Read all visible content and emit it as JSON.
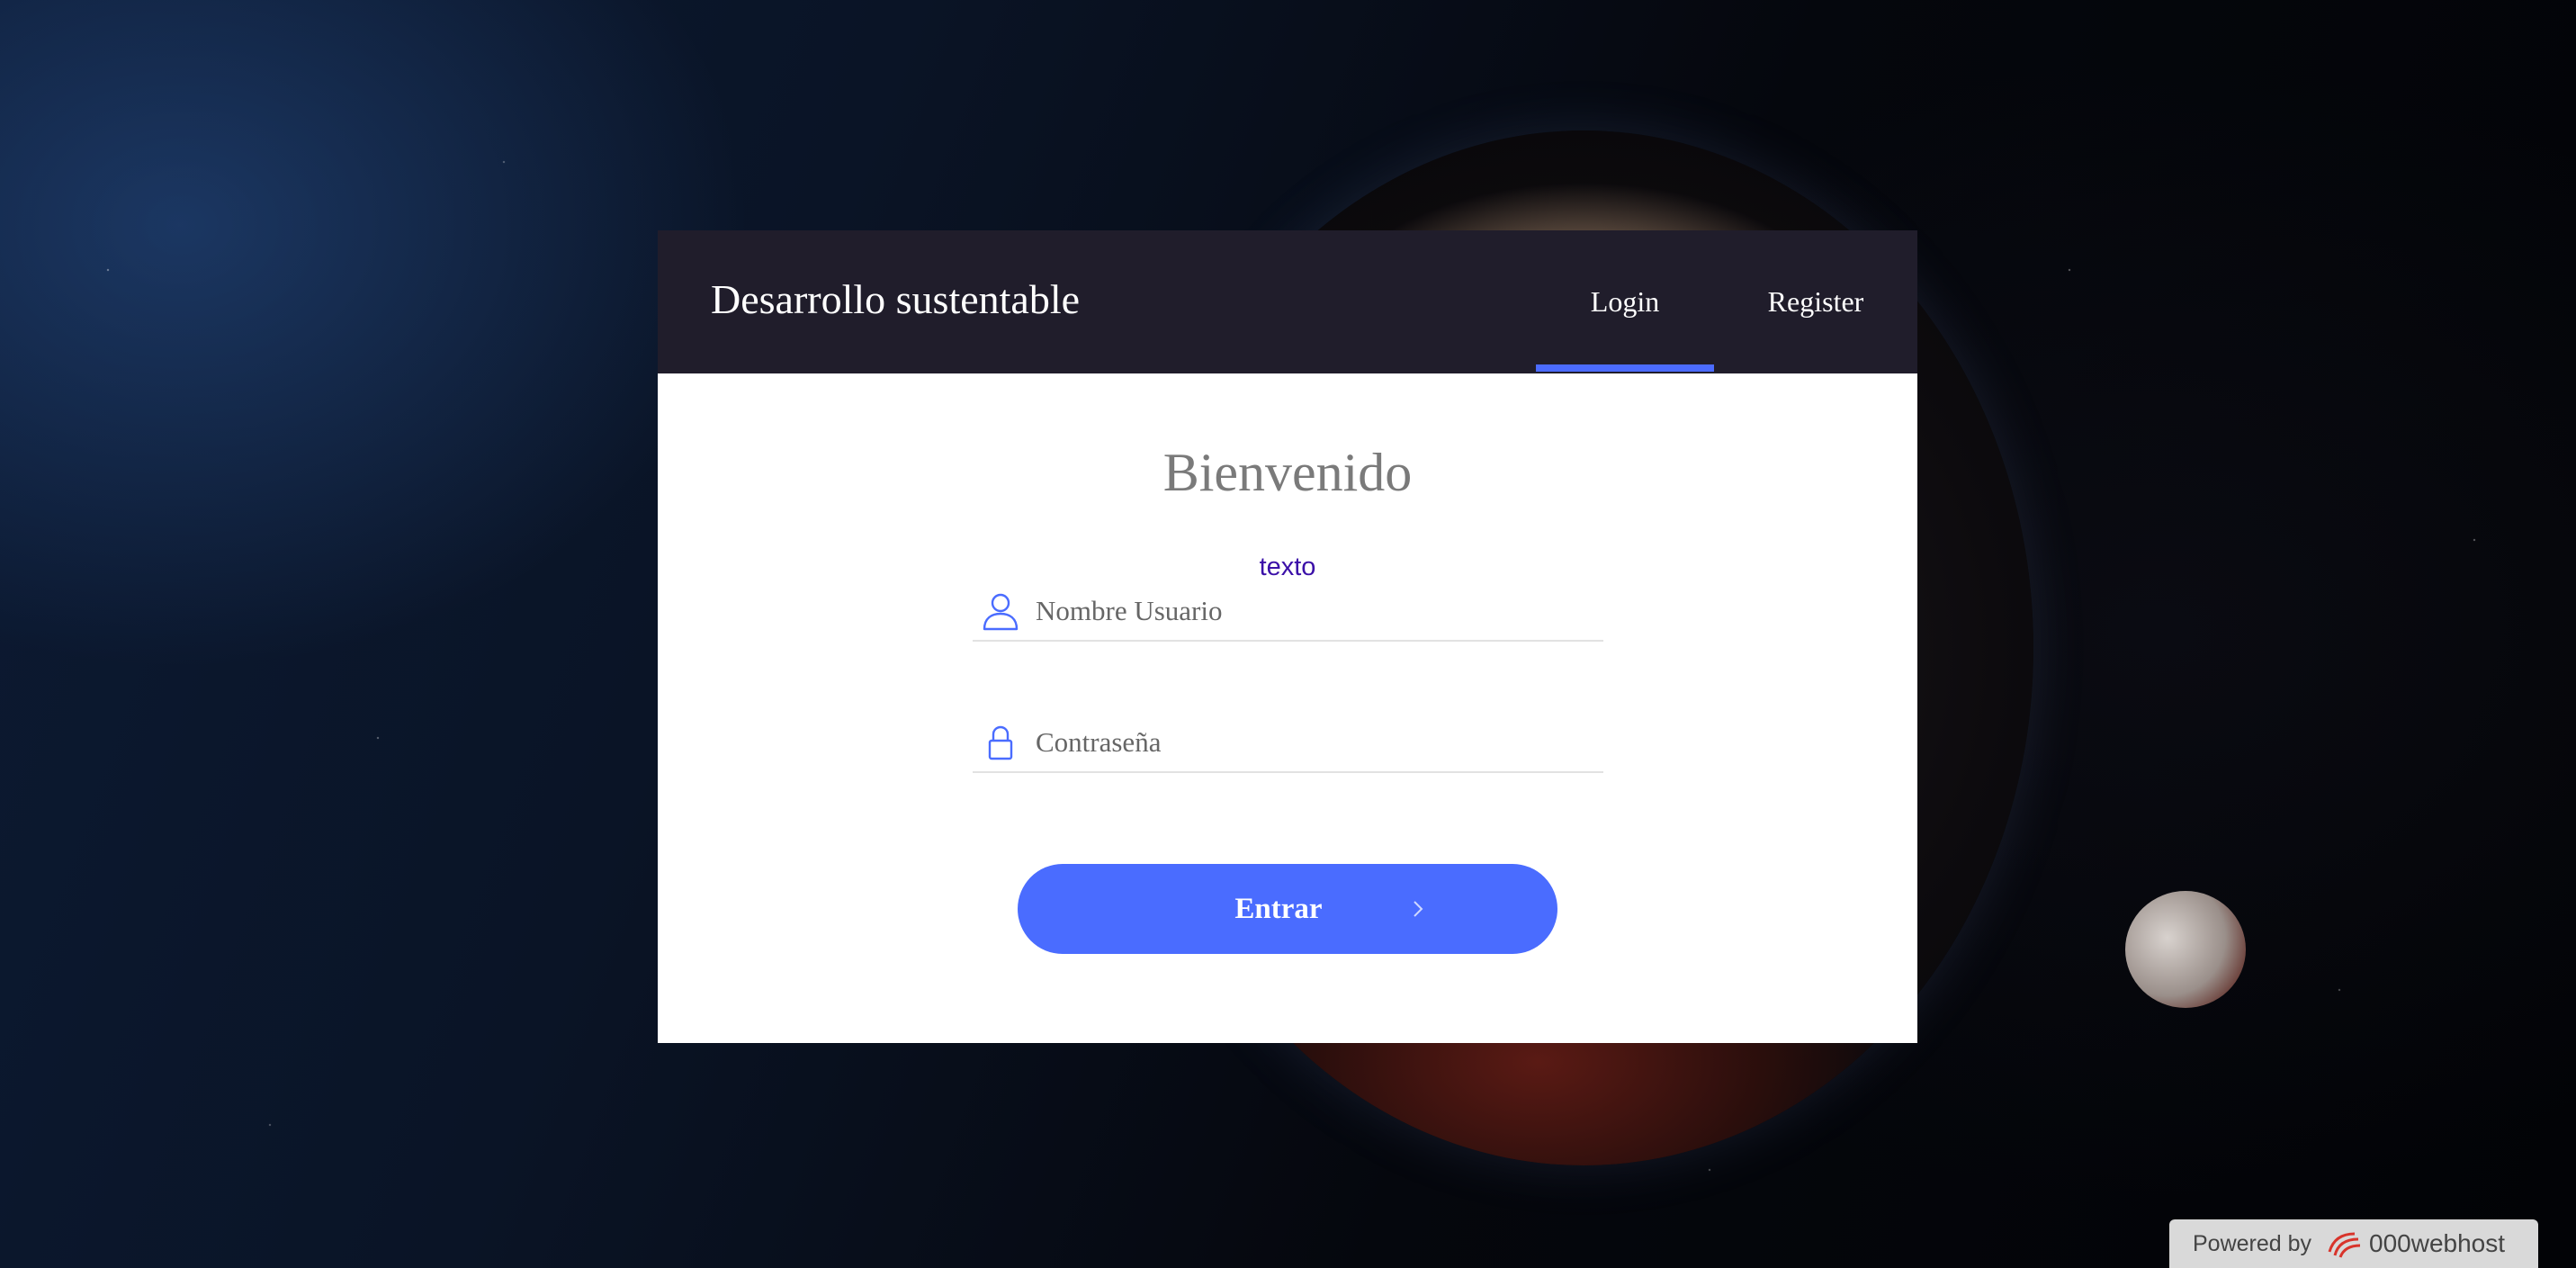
{
  "header": {
    "brand": "Desarrollo sustentable",
    "tabs": [
      {
        "label": "Login",
        "active": true
      },
      {
        "label": "Register",
        "active": false
      }
    ]
  },
  "form": {
    "title": "Bienvenido",
    "hint": "texto",
    "username": {
      "placeholder": "Nombre Usuario",
      "value": "",
      "icon": "user-icon"
    },
    "password": {
      "placeholder": "Contraseña",
      "value": "",
      "icon": "lock-icon"
    },
    "submit": {
      "label": "Entrar",
      "icon": "chevron-right-icon"
    }
  },
  "footer": {
    "powered_text": "Powered by",
    "brand": "000webhost",
    "icon": "000webhost-logo-icon"
  },
  "colors": {
    "accent": "#4a6cff",
    "header_bg": "#201d2b",
    "hint": "#3b10a8",
    "title": "#7a7a7a"
  }
}
